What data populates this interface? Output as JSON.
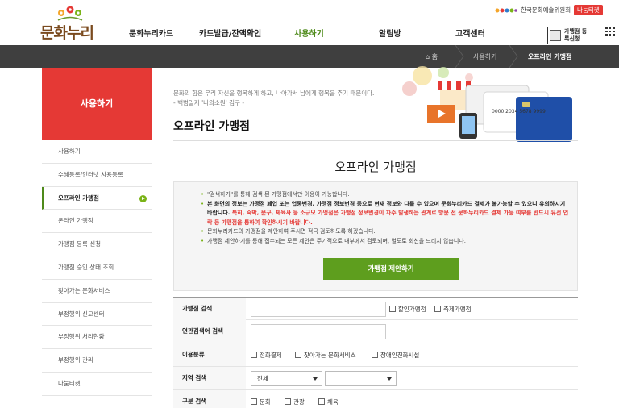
{
  "header": {
    "logo_text": "문화누리",
    "nav": [
      {
        "label": "문화누리카드",
        "active": false
      },
      {
        "label": "카드발급/잔액확인",
        "active": false
      },
      {
        "label": "사용하기",
        "active": true
      },
      {
        "label": "알림방",
        "active": false
      },
      {
        "label": "고객센터",
        "active": false
      }
    ],
    "arts_council": "한국문화예술위원회",
    "nanum_ticket": "나눔티켓",
    "register_badge": "가맹점 등록신청",
    "accent_color": "#4e8a1a",
    "brand_red": "#e53935"
  },
  "breadcrumb": {
    "home": "홈",
    "level1": "사용하기",
    "current": "오프라인 가맹점"
  },
  "sidebar": {
    "title": "사용하기",
    "items": [
      {
        "label": "사용하기",
        "active": false
      },
      {
        "label": "수혜등록/인터넷 사용등록",
        "active": false
      },
      {
        "label": "오프라인 가맹점",
        "active": true
      },
      {
        "label": "온라인 가맹점",
        "active": false
      },
      {
        "label": "가맹점 등록 신청",
        "active": false
      },
      {
        "label": "가맹점 승인 상태 조회",
        "active": false
      },
      {
        "label": "찾아가는 문화서비스",
        "active": false
      },
      {
        "label": "부정행위 신고센터",
        "active": false
      },
      {
        "label": "부정행위 처리현황",
        "active": false
      },
      {
        "label": "부정행위 관리",
        "active": false
      },
      {
        "label": "나눔티켓",
        "active": false
      }
    ]
  },
  "content": {
    "quote_line1": "문화의 힘은 우리 자신을 행복하게 하고, 나아가서 남에게 행복을 주기 때문이다.",
    "quote_line2": "- 백범일지 '나의소원' 김구 -",
    "page_title": "오프라인 가맹점",
    "card_number": "0000 2034 5678 9999",
    "section_title": "오프라인 가맹점",
    "notices": [
      {
        "parts": [
          {
            "t": "\"검색하기\"를 통해 검색 된 가맹점에서만 이용이 가능합니다.",
            "s": "n"
          }
        ]
      },
      {
        "parts": [
          {
            "t": "본 화면의 정보는 가맹점 폐업 또는 업종변경, 가맹점 정보변경 등으로 현재 정보와 다를 수 있으며 문화누리카드 결제가 불가능할 수 있으니 유의하시기 바랍니다.",
            "s": "b"
          },
          {
            "t": " 특히, 숙박, 문구, 체육사 등 소규모 가맹점은 가맹점 정보변경이 자주 발생하는 관계로 방문 전 문화누리카드 결제 가능 여부를 반드시 유선 연락 등 가맹점을 통하여 확인하시기 바랍니다.",
            "s": "r"
          }
        ]
      },
      {
        "parts": [
          {
            "t": "문화누리카드의 가맹점을 제안하여 주시면 적극 검토하도록 하겠습니다.",
            "s": "n"
          }
        ]
      },
      {
        "parts": [
          {
            "t": "가맹점 제안하기를 통해 접수되는 모든 제안은 주기적으로 내부에서 검토되며, 별도로 회신을 드리지 않습니다.",
            "s": "n"
          }
        ]
      }
    ],
    "propose_button": "가맹점 제안하기"
  },
  "form": {
    "store_search_label": "가맹점 검색",
    "store_search_value": "",
    "discount_label": "할인가맹점",
    "festival_label": "축제가맹점",
    "related_label": "연관검색어 검색",
    "related_value": "",
    "category_label": "이용분류",
    "category_options": [
      "전화결제",
      "찾아가는 문화서비스",
      "장애인친화시설"
    ],
    "region_label": "지역 검색",
    "region_selected": "전체",
    "region_sub_selected": "",
    "type_label": "구분 검색",
    "type_options": [
      "문화",
      "관광",
      "체육"
    ]
  }
}
